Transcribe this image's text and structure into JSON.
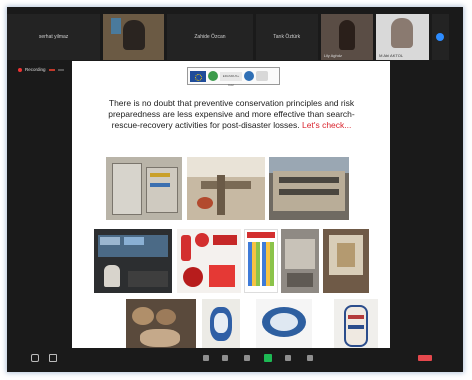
{
  "participants": [
    {
      "name": "serhat yilmaz",
      "video": false
    },
    {
      "name": "",
      "video": true
    },
    {
      "name": "Zahide Özcan",
      "video": false
    },
    {
      "name": "Tarık Öztürk",
      "video": false
    },
    {
      "name": "Lily Aghdz",
      "video": true
    },
    {
      "name": "M Abi AKTOL",
      "video": true
    }
  ],
  "recording": {
    "label": "Recording",
    "pause_label": "",
    "stop_label": ""
  },
  "slide": {
    "text_main": "There is no doubt that preventive conservation principles and risk preparedness are less expensive and more effective than search-rescue-recovery activities for post-disaster losses.",
    "text_emphasis": " Let's check...",
    "logo_text": "ERASMUS+ KA2"
  },
  "colors": {
    "emphasis": "#d9232d",
    "accent": "#2d8cff",
    "share": "#1db954",
    "end": "#e5484d"
  },
  "icons": [
    "mute-icon",
    "video-icon",
    "security-icon",
    "participants-icon",
    "share-screen-icon",
    "record-icon",
    "reactions-icon",
    "end-icon",
    "next-page-icon"
  ]
}
